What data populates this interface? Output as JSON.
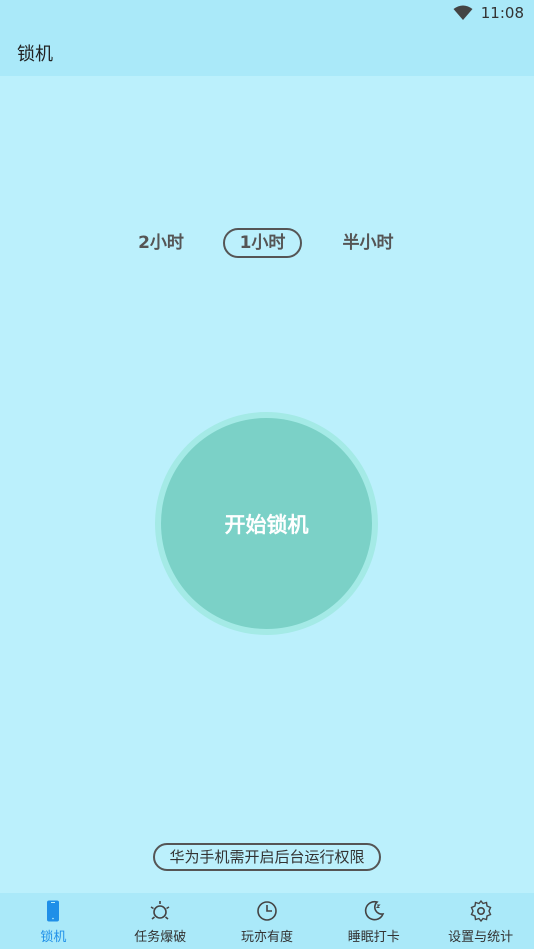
{
  "status_bar": {
    "time": "11:08",
    "wifi_icon": "wifi-icon"
  },
  "app_bar": {
    "title": "锁机"
  },
  "durations": {
    "items": [
      {
        "label": "2小时",
        "selected": false
      },
      {
        "label": "1小时",
        "selected": true
      },
      {
        "label": "半小时",
        "selected": false
      }
    ]
  },
  "lock_button": {
    "label": "开始锁机"
  },
  "permission_note": {
    "text": "华为手机需开启后台运行权限"
  },
  "bottom_nav": {
    "active_color": "#1f8fe8",
    "items": [
      {
        "label": "锁机",
        "icon": "phone-icon",
        "active": true
      },
      {
        "label": "任务爆破",
        "icon": "burst-icon",
        "active": false
      },
      {
        "label": "玩亦有度",
        "icon": "pie-clock-icon",
        "active": false
      },
      {
        "label": "睡眠打卡",
        "icon": "moon-icon",
        "active": false
      },
      {
        "label": "设置与统计",
        "icon": "gear-icon",
        "active": false
      }
    ]
  }
}
